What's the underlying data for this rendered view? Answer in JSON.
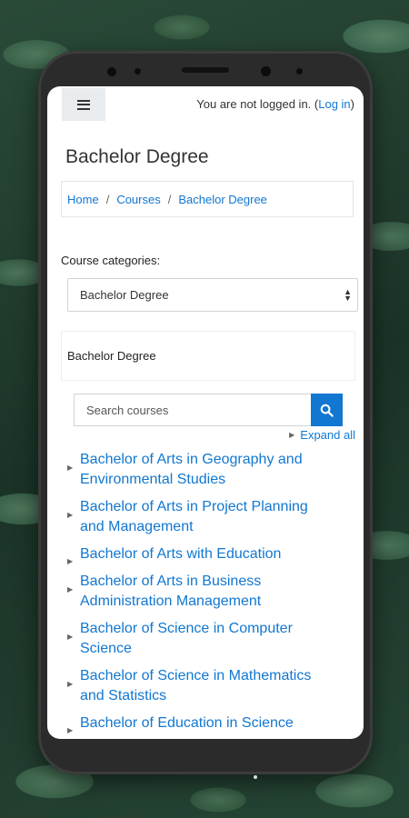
{
  "header": {
    "menu_label": "Menu",
    "login_prefix": "You are not logged in. (",
    "login_link": "Log in",
    "login_suffix": ")"
  },
  "page": {
    "title": "Bachelor Degree",
    "breadcrumb": [
      {
        "label": "Home"
      },
      {
        "label": "Courses"
      },
      {
        "label": "Bachelor Degree"
      }
    ],
    "breadcrumb_sep": "/"
  },
  "categories": {
    "label": "Course categories:",
    "selected": "Bachelor Degree",
    "box_title": "Bachelor Degree"
  },
  "search": {
    "placeholder": "Search courses",
    "value": ""
  },
  "expand_all": "Expand all",
  "courses": [
    {
      "line1": "Bachelor of Arts in Geography and",
      "line2": "Environmental Studies"
    },
    {
      "line1": "Bachelor of Arts in Project Planning",
      "line2": "and Management"
    },
    {
      "line1": "Bachelor of Arts with Education",
      "line2": ""
    },
    {
      "line1": "Bachelor of Arts in Business",
      "line2": "Administration Management"
    },
    {
      "line1": "Bachelor of Science in Computer",
      "line2": "Science"
    },
    {
      "line1": "Bachelor of Science in Mathematics",
      "line2": "and Statistics"
    },
    {
      "line1": "Bachelor of Education in Science",
      "line2": ""
    }
  ],
  "colors": {
    "link": "#1177d1",
    "button": "#1177d1",
    "text": "#333333"
  },
  "icons": {
    "menu": "hamburger-icon",
    "search": "search-icon",
    "expand": "caret-right-icon"
  }
}
